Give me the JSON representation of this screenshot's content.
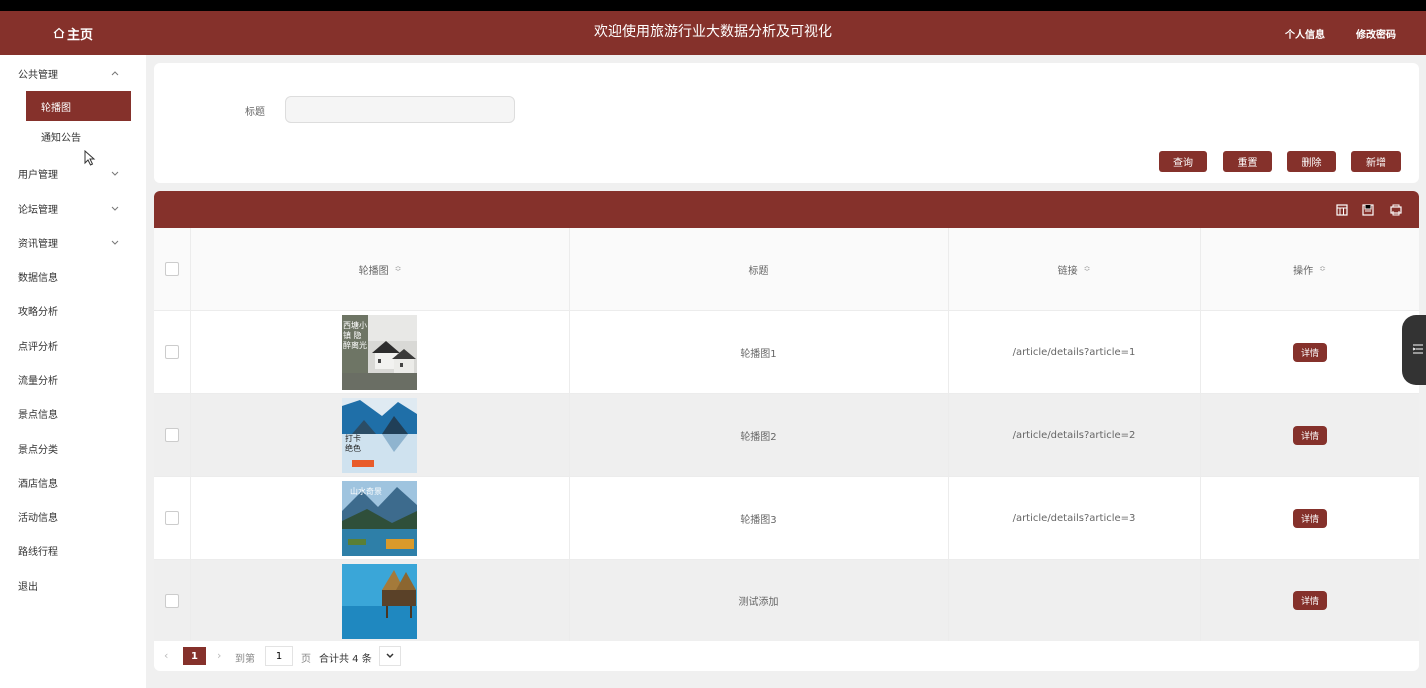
{
  "header": {
    "home_label": "主页",
    "title": "欢迎使用旅游行业大数据分析及可视化",
    "profile_link": "个人信息",
    "password_link": "修改密码"
  },
  "sidebar": {
    "items": [
      {
        "label": "公共管理",
        "expanded": true,
        "children": [
          {
            "label": "轮播图",
            "active": true
          },
          {
            "label": "通知公告",
            "active": false
          }
        ]
      },
      {
        "label": "用户管理"
      },
      {
        "label": "论坛管理"
      },
      {
        "label": "资讯管理"
      },
      {
        "label": "数据信息"
      },
      {
        "label": "攻略分析"
      },
      {
        "label": "点评分析"
      },
      {
        "label": "流量分析"
      },
      {
        "label": "景点信息"
      },
      {
        "label": "景点分类"
      },
      {
        "label": "酒店信息"
      },
      {
        "label": "活动信息"
      },
      {
        "label": "路线行程"
      },
      {
        "label": "退出"
      }
    ]
  },
  "search": {
    "label": "标题",
    "value": "",
    "placeholder": ""
  },
  "buttons": {
    "query": "查询",
    "reset": "重置",
    "delete": "删除",
    "add": "新增"
  },
  "table": {
    "columns": [
      "轮播图",
      "标题",
      "链接",
      "操作"
    ],
    "rows": [
      {
        "title": "轮播图1",
        "link": "/article/details?article=1",
        "action": "详情"
      },
      {
        "title": "轮播图2",
        "link": "/article/details?article=2",
        "action": "详情"
      },
      {
        "title": "轮播图3",
        "link": "/article/details?article=3",
        "action": "详情"
      },
      {
        "title": "测试添加",
        "link": "",
        "action": "详情"
      }
    ]
  },
  "pagination": {
    "current_page": "1",
    "goto_label": "到第",
    "goto_value": "1",
    "page_label": "页",
    "total_text": "合计共 4 条"
  },
  "thumb_texts": {
    "t1": "西塘小镇 隐醉离光",
    "t2": "打卡绝色",
    "t3": "山水奇景"
  },
  "colors": {
    "brand": "#85312b",
    "background": "#f0f0f0"
  }
}
